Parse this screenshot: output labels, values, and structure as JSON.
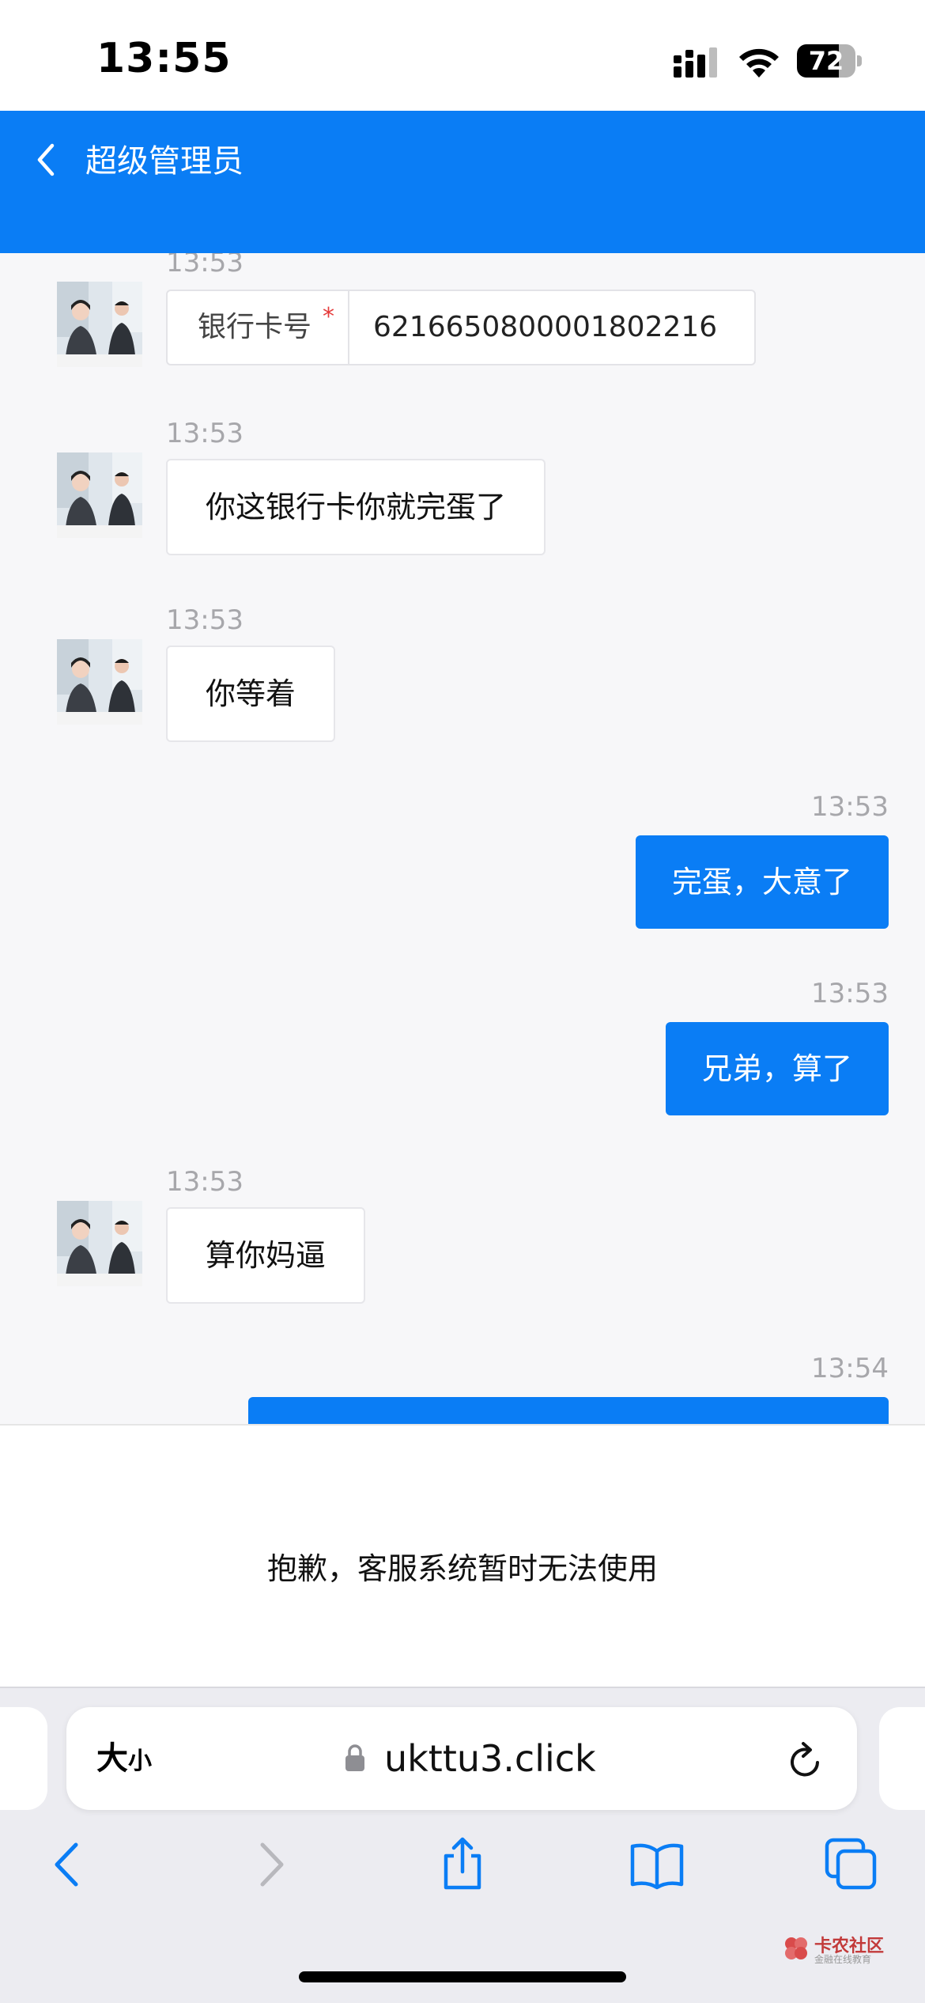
{
  "status_bar": {
    "time": "13:55",
    "battery": "72",
    "battery_level": 0.72
  },
  "header": {
    "title": "超级管理员"
  },
  "chat": {
    "messages": [
      {
        "side": "in",
        "time": "13:53",
        "type": "card",
        "label": "银行卡号",
        "required_mark": "*",
        "value": "6216650800001802216"
      },
      {
        "side": "in",
        "time": "13:53",
        "text": "你这银行卡你就完蛋了"
      },
      {
        "side": "in",
        "time": "13:53",
        "text": "你等着"
      },
      {
        "side": "out",
        "time": "13:53",
        "text": "完蛋，大意了"
      },
      {
        "side": "out",
        "time": "13:53",
        "text": "兄弟，算了"
      },
      {
        "side": "in",
        "time": "13:53",
        "text": "算你妈逼"
      },
      {
        "side": "out",
        "time": "13:54",
        "text": ""
      }
    ]
  },
  "notice": {
    "text": "抱歉，客服系统暂时无法使用"
  },
  "safari": {
    "text_size_big": "大",
    "text_size_small": "小",
    "url": "ukttu3.click"
  },
  "watermark": {
    "title": "卡农社区",
    "subtitle": "金融在线教育"
  },
  "colors": {
    "accent": "#0a7df5",
    "chat_bg": "#f7f7f9"
  }
}
